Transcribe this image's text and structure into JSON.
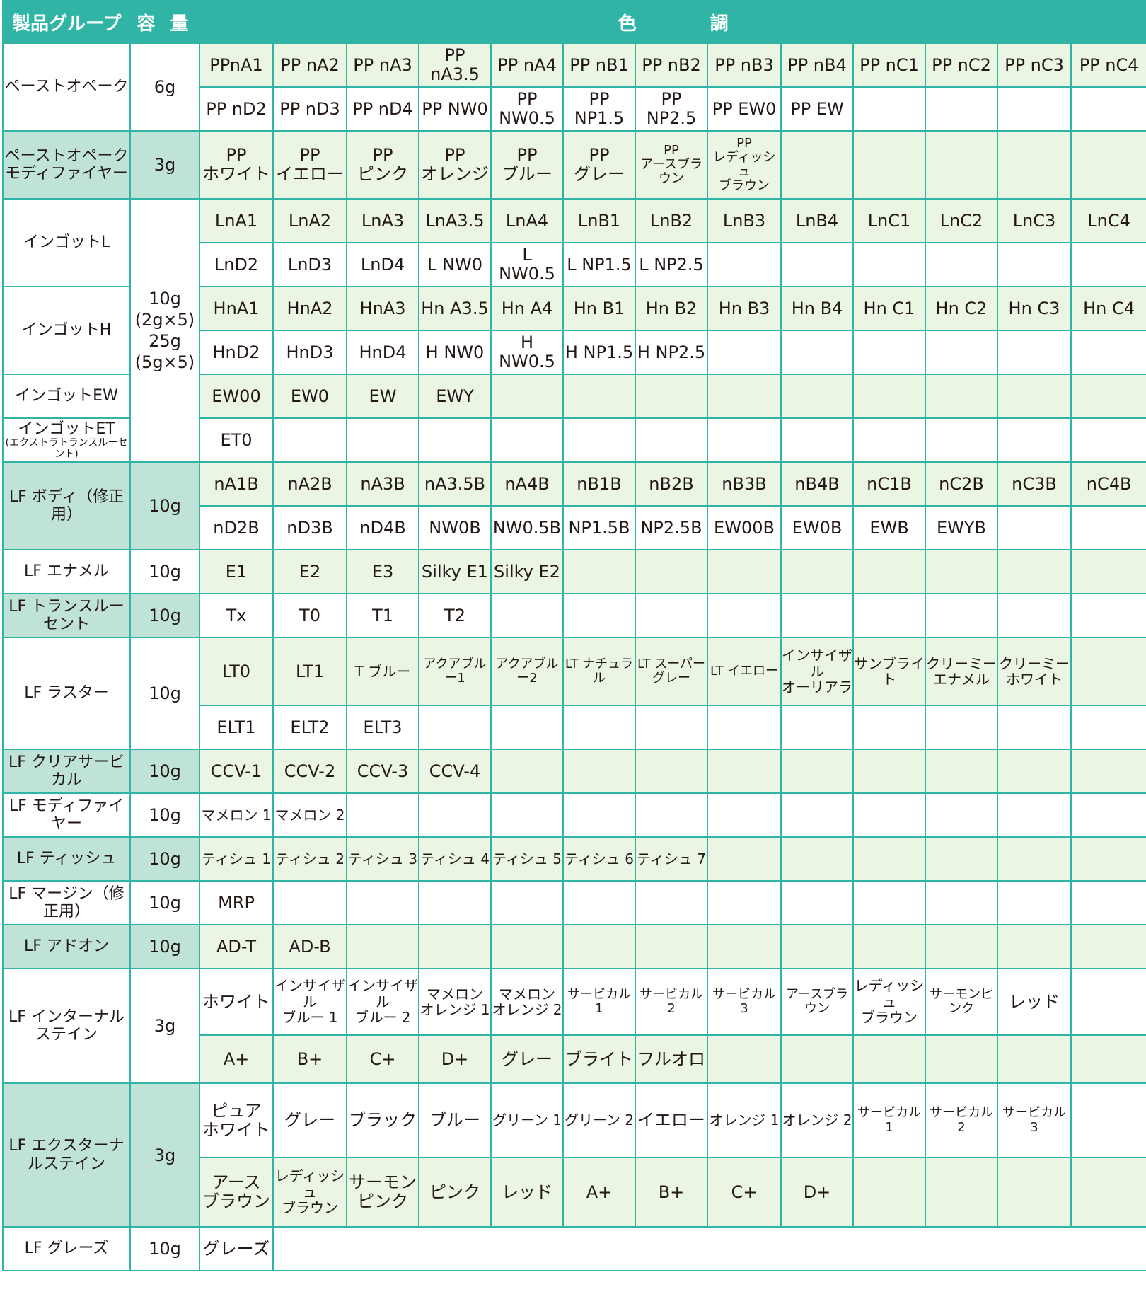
{
  "header": {
    "group": "製品グループ",
    "capacity": "容 量",
    "color": "色　　　　調"
  },
  "rows": [
    {
      "group": "ペーストオペーク",
      "group_green": false,
      "cap": "6g",
      "cap_green": false,
      "lines": [
        {
          "bg": "g",
          "cells": [
            "PPnA1",
            "PP nA2",
            "PP nA3",
            "PP nA3.5",
            "PP nA4",
            "PP nB1",
            "PP nB2",
            "PP nB3",
            "PP nB4",
            "PP nC1",
            "PP nC2",
            "PP nC3",
            "PP nC4"
          ]
        },
        {
          "bg": "w",
          "cells": [
            "PP nD2",
            "PP nD3",
            "PP nD4",
            "PP NW0",
            "PP NW0.5",
            "PP NP1.5",
            "PP NP2.5",
            "PP EW0",
            "PP EW",
            "",
            "",
            "",
            ""
          ]
        }
      ]
    },
    {
      "group": "ペーストオペーク\nモディファイヤー",
      "group_green": true,
      "cap": "3g",
      "cap_green": true,
      "lines": [
        {
          "bg": "g",
          "h": 96,
          "cells": [
            "PP\nホワイト",
            "PP\nイエロー",
            "PP\nピンク",
            "PP\nオレンジ",
            "PP\nブルー",
            "PP\nグレー",
            "PP\nアースブラウン",
            "PP\nレディッシュ\nブラウン",
            "",
            "",
            "",
            "",
            ""
          ]
        }
      ]
    },
    {
      "group": "インゴットL",
      "group_green": false,
      "cap": "10g\n(2g×5)\n25g\n(5g×5)",
      "cap_green": false,
      "cap_span": 4,
      "lines": [
        {
          "bg": "g",
          "cells": [
            "LnA1",
            "LnA2",
            "LnA3",
            "LnA3.5",
            "LnA4",
            "LnB1",
            "LnB2",
            "LnB3",
            "LnB4",
            "LnC1",
            "LnC2",
            "LnC3",
            "LnC4"
          ]
        },
        {
          "bg": "w",
          "cells": [
            "LnD2",
            "LnD3",
            "LnD4",
            "L NW0",
            "L NW0.5",
            "L NP1.5",
            "L NP2.5",
            "",
            "",
            "",
            "",
            "",
            ""
          ]
        }
      ]
    },
    {
      "group": "インゴットH",
      "group_green": false,
      "lines": [
        {
          "bg": "g",
          "cells": [
            "HnA1",
            "HnA2",
            "HnA3",
            "Hn A3.5",
            "Hn A4",
            "Hn B1",
            "Hn B2",
            "Hn B3",
            "Hn B4",
            "Hn C1",
            "Hn C2",
            "Hn C3",
            "Hn C4"
          ]
        },
        {
          "bg": "w",
          "cells": [
            "HnD2",
            "HnD3",
            "HnD4",
            "H NW0",
            "H NW0.5",
            "H NP1.5",
            "H NP2.5",
            "",
            "",
            "",
            "",
            "",
            ""
          ]
        }
      ]
    },
    {
      "group": "インゴットEW",
      "group_green": false,
      "lines": [
        {
          "bg": "g",
          "cells": [
            "EW00",
            "EW0",
            "EW",
            "EWY",
            "",
            "",
            "",
            "",
            "",
            "",
            "",
            "",
            ""
          ]
        }
      ]
    },
    {
      "group": "インゴットET",
      "group_small": "(エクストラトランスルーセント)",
      "group_green": false,
      "lines": [
        {
          "bg": "w",
          "cells": [
            "ET0",
            "",
            "",
            "",
            "",
            "",
            "",
            "",
            "",
            "",
            "",
            "",
            ""
          ]
        }
      ]
    },
    {
      "group": "LF ボディ（修正用）",
      "group_green": true,
      "cap": "10g",
      "cap_green": true,
      "lines": [
        {
          "bg": "g",
          "cells": [
            "nA1B",
            "nA2B",
            "nA3B",
            "nA3.5B",
            "nA4B",
            "nB1B",
            "nB2B",
            "nB3B",
            "nB4B",
            "nC1B",
            "nC2B",
            "nC3B",
            "nC4B"
          ]
        },
        {
          "bg": "w",
          "cells": [
            "nD2B",
            "nD3B",
            "nD4B",
            "NW0B",
            "NW0.5B",
            "NP1.5B",
            "NP2.5B",
            "EW00B",
            "EW0B",
            "EWB",
            "EWYB",
            "",
            ""
          ]
        }
      ]
    },
    {
      "group": "LF エナメル",
      "group_green": false,
      "cap": "10g",
      "cap_green": false,
      "lines": [
        {
          "bg": "g",
          "cells": [
            "E1",
            "E2",
            "E3",
            "Silky E1",
            "Silky E2",
            "",
            "",
            "",
            "",
            "",
            "",
            "",
            ""
          ]
        }
      ]
    },
    {
      "group": "LF トランスルーセント",
      "group_green": true,
      "cap": "10g",
      "cap_green": true,
      "lines": [
        {
          "bg": "w",
          "cells": [
            "Tx",
            "T0",
            "T1",
            "T2",
            "",
            "",
            "",
            "",
            "",
            "",
            "",
            "",
            ""
          ]
        }
      ]
    },
    {
      "group": "LF ラスター",
      "group_green": false,
      "cap": "10g",
      "cap_green": false,
      "lines": [
        {
          "bg": "g",
          "h": 96,
          "cells": [
            "LT0",
            "LT1",
            "T ブルー",
            "アクアブルー1",
            "アクアブルー2",
            "LT ナチュラル",
            "LT スーパーグレー",
            "LT イエロー",
            "インサイザル\nオーリアラ",
            "サンブライト",
            "クリーミー\nエナメル",
            "クリーミー\nホワイト",
            ""
          ]
        },
        {
          "bg": "w",
          "cells": [
            "ELT1",
            "ELT2",
            "ELT3",
            "",
            "",
            "",
            "",
            "",
            "",
            "",
            "",
            "",
            ""
          ]
        }
      ]
    },
    {
      "group": "LF クリアサービカル",
      "group_green": true,
      "cap": "10g",
      "cap_green": true,
      "lines": [
        {
          "bg": "g",
          "cells": [
            "CCV-1",
            "CCV-2",
            "CCV-3",
            "CCV-4",
            "",
            "",
            "",
            "",
            "",
            "",
            "",
            "",
            ""
          ]
        }
      ]
    },
    {
      "group": "LF モディファイヤー",
      "group_green": false,
      "cap": "10g",
      "cap_green": false,
      "lines": [
        {
          "bg": "w",
          "cells": [
            "マメロン 1",
            "マメロン 2",
            "",
            "",
            "",
            "",
            "",
            "",
            "",
            "",
            "",
            "",
            ""
          ]
        }
      ]
    },
    {
      "group": "LF ティッシュ",
      "group_green": true,
      "cap": "10g",
      "cap_green": true,
      "lines": [
        {
          "bg": "g",
          "cells": [
            "ティシュ 1",
            "ティシュ 2",
            "ティシュ 3",
            "ティシュ 4",
            "ティシュ 5",
            "ティシュ 6",
            "ティシュ 7",
            "",
            "",
            "",
            "",
            "",
            ""
          ]
        }
      ]
    },
    {
      "group": "LF マージン（修正用）",
      "group_green": false,
      "cap": "10g",
      "cap_green": false,
      "lines": [
        {
          "bg": "w",
          "cells": [
            "MRP",
            "",
            "",
            "",
            "",
            "",
            "",
            "",
            "",
            "",
            "",
            "",
            ""
          ]
        }
      ]
    },
    {
      "group": "LF アドオン",
      "group_green": true,
      "cap": "10g",
      "cap_green": true,
      "lines": [
        {
          "bg": "g",
          "cells": [
            "AD-T",
            "AD-B",
            "",
            "",
            "",
            "",
            "",
            "",
            "",
            "",
            "",
            "",
            ""
          ]
        }
      ]
    },
    {
      "group": "LF インターナルステイン",
      "group_green": false,
      "cap": "3g",
      "cap_green": false,
      "lines": [
        {
          "bg": "w",
          "h": 94,
          "cells": [
            "ホワイト",
            "インサイザル\nブルー 1",
            "インサイザル\nブルー 2",
            "マメロン\nオレンジ 1",
            "マメロン\nオレンジ 2",
            "サービカル 1",
            "サービカル 2",
            "サービカル 3",
            "アースブラウン",
            "レディッシュ\nブラウン",
            "サーモンピンク",
            "レッド",
            ""
          ]
        },
        {
          "bg": "g",
          "h": 68,
          "cells": [
            "A+",
            "B+",
            "C+",
            "D+",
            "グレー",
            "ブライト",
            "フルオロ",
            "",
            "",
            "",
            "",
            "",
            ""
          ]
        }
      ]
    },
    {
      "group": "LF エクスターナルステイン",
      "group_green": true,
      "cap": "3g",
      "cap_green": true,
      "lines": [
        {
          "bg": "w",
          "h": 105,
          "cells": [
            "ピュア\nホワイト",
            "グレー",
            "ブラック",
            "ブルー",
            "グリーン 1",
            "グリーン 2",
            "イエロー",
            "オレンジ 1",
            "オレンジ 2",
            "サービカル 1",
            "サービカル 2",
            "サービカル 3",
            ""
          ]
        },
        {
          "bg": "g",
          "h": 98,
          "cells": [
            "アース\nブラウン",
            "レディッシュ\nブラウン",
            "サーモン\nピンク",
            "ピンク",
            "レッド",
            "A+",
            "B+",
            "C+",
            "D+",
            "",
            "",
            "",
            ""
          ]
        }
      ]
    },
    {
      "group": "LF グレーズ",
      "group_green": false,
      "cap": "10g",
      "cap_green": false,
      "single_span": true,
      "lines": [
        {
          "bg": "w",
          "cells": [
            "グレーズ"
          ]
        }
      ]
    }
  ],
  "colors": {
    "teal": "#2fb4a5",
    "group_green": "#bfe3d6",
    "row_green": "#ebf5e4"
  }
}
